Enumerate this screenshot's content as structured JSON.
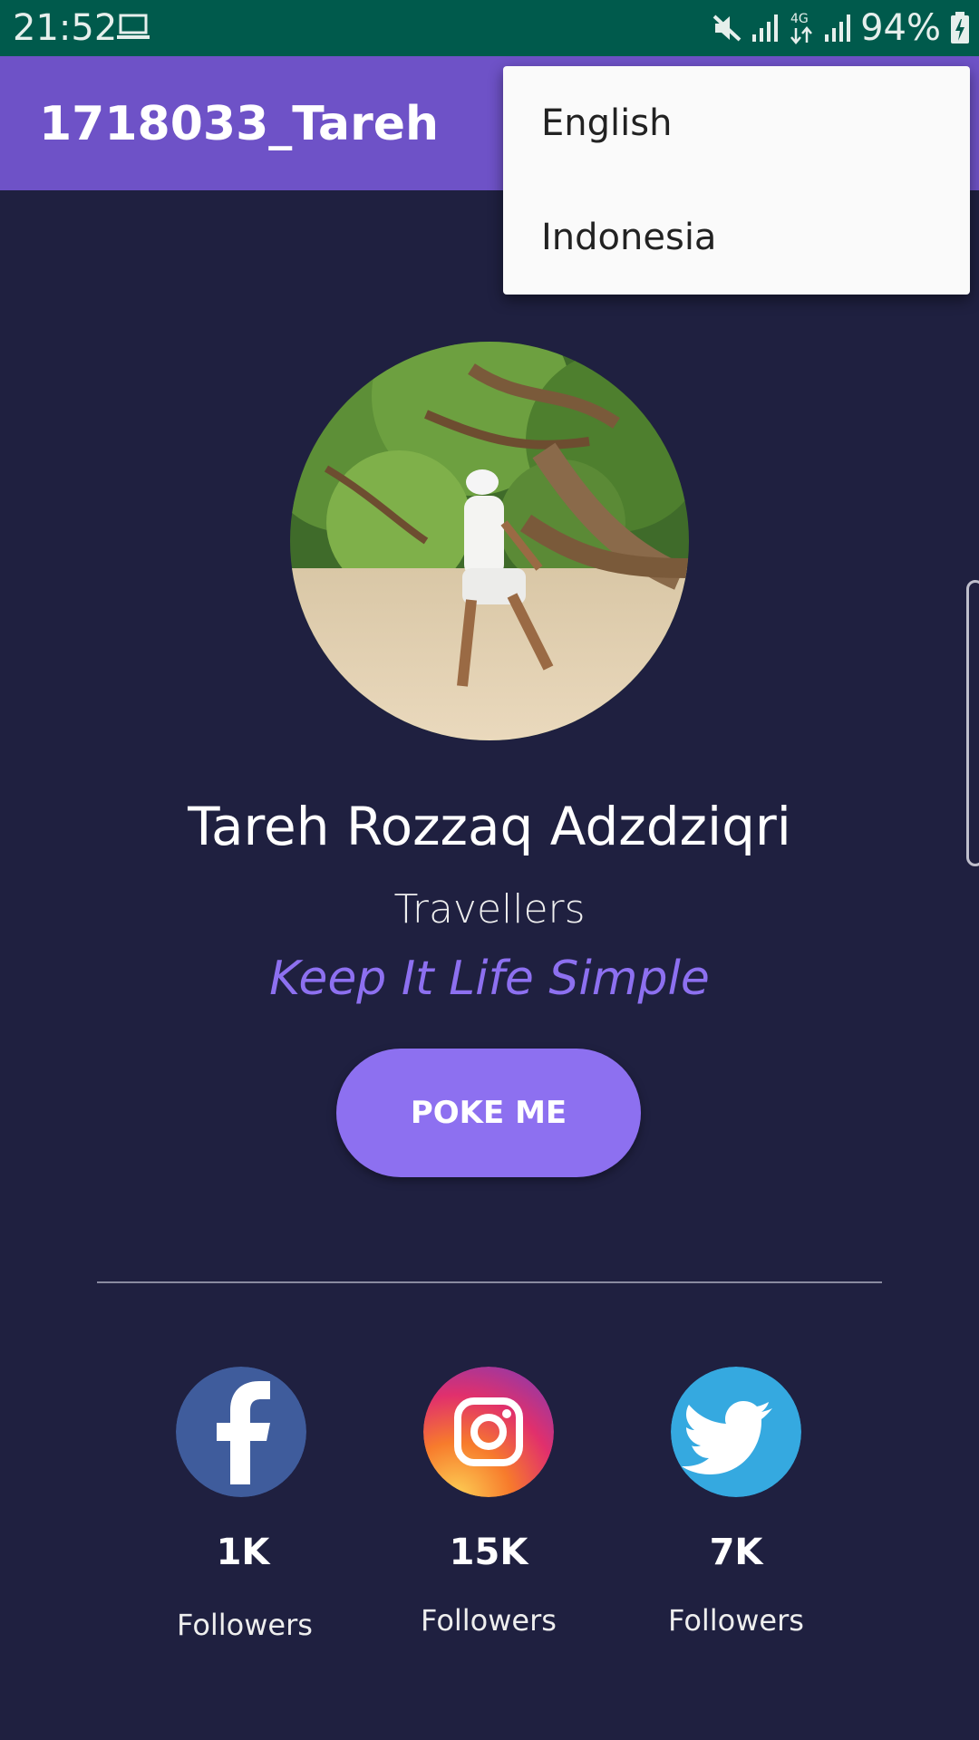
{
  "status_bar": {
    "time": "21:52",
    "battery": "94%",
    "network": "4G",
    "icons": [
      "laptop-icon",
      "mute-icon",
      "signal-icon",
      "network-4g-icon",
      "signal-icon",
      "battery-charging-icon"
    ]
  },
  "app_bar": {
    "title": "1718033_Tareh"
  },
  "popup_menu": {
    "items": [
      {
        "label": "English"
      },
      {
        "label": "Indonesia"
      }
    ]
  },
  "profile": {
    "name": "Tareh Rozzaq Adzdziqri",
    "role": "Travellers",
    "motto": "Keep It Life Simple",
    "button_label": "POKE ME"
  },
  "social": [
    {
      "network": "facebook",
      "icon": "facebook-icon",
      "count": "1K",
      "label": "Followers",
      "color": "#3f5c9c"
    },
    {
      "network": "instagram",
      "icon": "instagram-icon",
      "count": "15K",
      "label": "Followers",
      "color": "#e1306c"
    },
    {
      "network": "twitter",
      "icon": "twitter-icon",
      "count": "7K",
      "label": "Followers",
      "color": "#35a9e0"
    }
  ],
  "colors": {
    "status_bar": "#005a4c",
    "app_bar": "#6e52c7",
    "background": "#1f2040",
    "accent": "#8d70f0"
  }
}
